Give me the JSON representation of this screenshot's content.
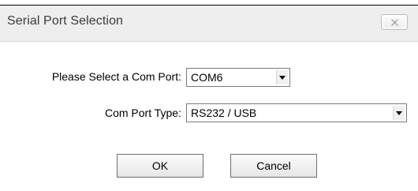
{
  "window": {
    "title": "Serial Port Selection"
  },
  "form": {
    "com_port_label": "Please Select a Com Port:",
    "com_port_value": "COM6",
    "com_port_type_label": "Com Port Type:",
    "com_port_type_value": "RS232 / USB"
  },
  "buttons": {
    "ok_label": "OK",
    "cancel_label": "Cancel"
  },
  "icons": {
    "close": "close-icon",
    "dropdown": "chevron-down-icon"
  }
}
